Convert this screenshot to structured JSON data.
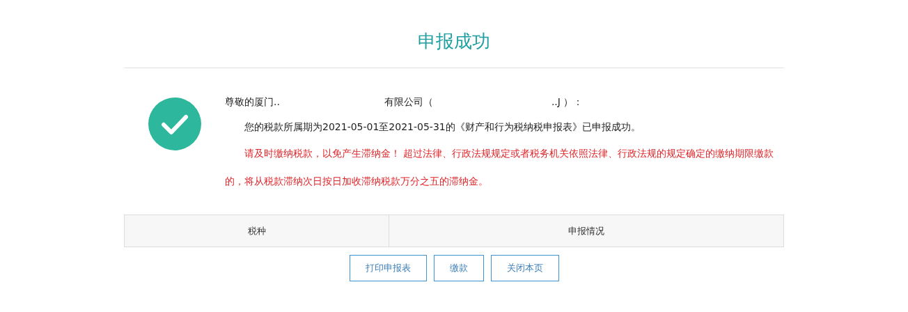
{
  "title": "申报成功",
  "greeting": [
    "尊敬的厦门..",
    "有限公司（",
    "..J ）："
  ],
  "message": "您的税款所属期为2021-05-01至2021-05-31的《财产和行为税纳税申报表》已申报成功。",
  "warning": "请及时缴纳税款，以免产生滞纳金！ 超过法律、行政法规规定或者税务机关依照法律、行政法规的规定确定的缴纳期限缴款的，将从税款滞纳次日按日加收滞纳税款万分之五的滞纳金。",
  "table": {
    "columns": [
      "税种",
      "申报情况"
    ]
  },
  "buttons": [
    "打印申报表",
    "缴款",
    "关闭本页"
  ]
}
